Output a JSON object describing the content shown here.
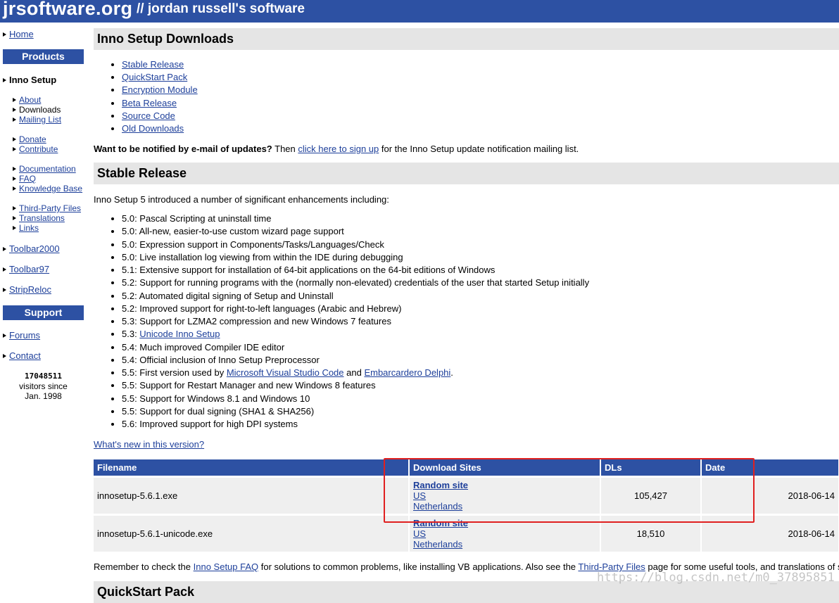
{
  "header": {
    "site": "jrsoftware.org",
    "subtitle": "// jordan russell's software"
  },
  "sidebar": {
    "home": "Home",
    "products_heading": "Products",
    "inno_setup": "Inno Setup",
    "inno_sub": [
      "About",
      "Downloads",
      "Mailing List",
      "Donate",
      "Contribute",
      "Documentation",
      "FAQ",
      "Knowledge Base",
      "Third-Party Files",
      "Translations",
      "Links"
    ],
    "toolbar2000": "Toolbar2000",
    "toolbar97": "Toolbar97",
    "stripreloc": "StripReloc",
    "support_heading": "Support",
    "forums": "Forums",
    "contact": "Contact",
    "counter": "17048511",
    "counter_line1": "visitors since",
    "counter_line2": "Jan. 1998"
  },
  "main": {
    "title": "Inno Setup Downloads",
    "links": [
      "Stable Release",
      "QuickStart Pack",
      "Encryption Module",
      "Beta Release",
      "Source Code",
      "Old Downloads"
    ],
    "notify_bold": "Want to be notified by e-mail of updates?",
    "notify_then": " Then ",
    "notify_link": "click here to sign up",
    "notify_rest": " for the Inno Setup update notification mailing list.",
    "stable_title": "Stable Release",
    "intro": "Inno Setup 5 introduced a number of significant enhancements including:",
    "features": [
      "5.0: Pascal Scripting at uninstall time",
      "5.0: All-new, easier-to-use custom wizard page support",
      "5.0: Expression support in Components/Tasks/Languages/Check",
      "5.0: Live installation log viewing from within the IDE during debugging",
      "5.1: Extensive support for installation of 64-bit applications on the 64-bit editions of Windows",
      "5.2: Support for running programs with the (normally non-elevated) credentials of the user that started Setup initially",
      "5.2: Automated digital signing of Setup and Uninstall",
      "5.2: Improved support for right-to-left languages (Arabic and Hebrew)",
      "5.3: Support for LZMA2 compression and new Windows 7 features"
    ],
    "f_unicode_prefix": "5.3: ",
    "f_unicode_link": "Unicode Inno Setup",
    "f_compiler": "5.4: Much improved Compiler IDE editor",
    "f_preproc": "5.4: Official inclusion of Inno Setup Preprocessor",
    "f_first_prefix": "5.5: First version used by ",
    "f_first_link1": "Microsoft Visual Studio Code",
    "f_first_and": " and ",
    "f_first_link2": "Embarcardero Delphi",
    "f_first_end": ".",
    "features2": [
      "5.5: Support for Restart Manager and new Windows 8 features",
      "5.5: Support for Windows 8.1 and Windows 10",
      "5.5: Support for dual signing (SHA1 & SHA256)",
      "5.6: Improved support for high DPI systems"
    ],
    "whats_new": "What's new in this version?",
    "table": {
      "headers": [
        "Filename",
        "Download Sites",
        "DLs",
        "Date"
      ],
      "rows": [
        {
          "filename": "innosetup-5.6.1.exe",
          "sites": [
            "Random site",
            "US",
            "Netherlands"
          ],
          "dls": "105,427",
          "date": "2018-06-14"
        },
        {
          "filename": "innosetup-5.6.1-unicode.exe",
          "sites": [
            "Random site",
            "US",
            "Netherlands"
          ],
          "dls": "18,510",
          "date": "2018-06-14"
        }
      ]
    },
    "remember_pre": "Remember to check the ",
    "remember_faq": "Inno Setup FAQ",
    "remember_mid": " for solutions to common problems, like installing VB applications. Also see the ",
    "remember_tpf": "Third-Party Files",
    "remember_post": " page for some useful tools, and translations of s",
    "quickstart_title": "QuickStart Pack"
  },
  "watermark": "https://blog.csdn.net/m0_37895851",
  "colors": {
    "header_blue": "#2d51a3",
    "link": "#1d3f9a",
    "section_gray": "#e5e5e5",
    "highlight_red": "#e02020"
  }
}
